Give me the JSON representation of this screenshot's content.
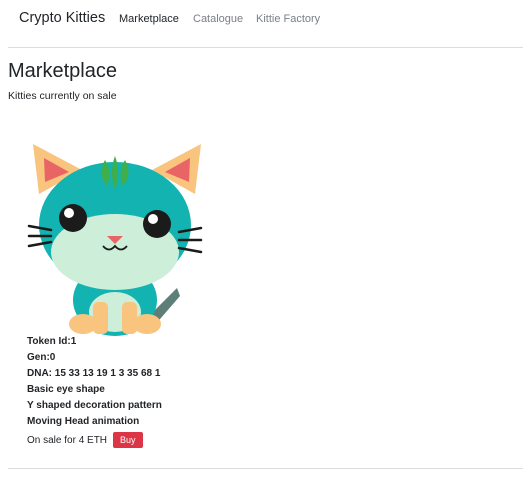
{
  "navbar": {
    "brand": "Crypto Kitties",
    "links": [
      {
        "label": "Marketplace",
        "active": true
      },
      {
        "label": "Catalogue",
        "active": false
      },
      {
        "label": "Kittie Factory",
        "active": false
      }
    ]
  },
  "page": {
    "title": "Marketplace",
    "subtitle": "Kitties currently on sale"
  },
  "kitty": {
    "token_id": "Token Id:1",
    "gen": "Gen:0",
    "dna": "DNA: 15 33 13 19 1 3 35 68 1",
    "eye_shape": "Basic eye shape",
    "decoration": "Y shaped decoration pattern",
    "animation": "Moving Head animation",
    "sale_text": "On sale for 4 ETH",
    "buy_label": "Buy",
    "colors": {
      "head": "#12b3b0",
      "mouth_body": "#cdeed9",
      "ears_paws": "#f9c47e",
      "inner_ear": "#e96565",
      "decoration": "#3fae4b",
      "tail": "#5d7f78"
    }
  },
  "colors": {
    "buy_button": "#dc3545"
  }
}
